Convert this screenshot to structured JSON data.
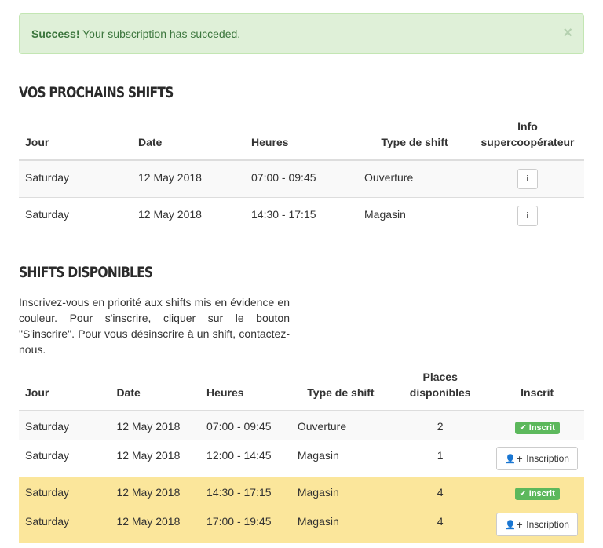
{
  "alert": {
    "strong": "Success!",
    "message": " Your subscription has succeded.",
    "close": "×"
  },
  "upcoming": {
    "title": "Vos prochains shifts",
    "headers": {
      "jour": "Jour",
      "date": "Date",
      "heures": "Heures",
      "type": "Type de shift",
      "info_line1": "Info",
      "info_line2": "supercoopérateur"
    },
    "info_icon": "i",
    "rows": [
      {
        "jour": "Saturday",
        "date": "12 May 2018",
        "heures": "07:00 - 09:45",
        "type": "Ouverture"
      },
      {
        "jour": "Saturday",
        "date": "12 May 2018",
        "heures": "14:30 - 17:15",
        "type": "Magasin"
      }
    ]
  },
  "available": {
    "title": "Shifts disponibles",
    "intro": "Inscrivez-vous en priorité aux shifts mis en évidence en couleur. Pour s'inscrire, cliquer sur le bouton \"S'inscrire\". Pour vous désinscrire à un shift, contactez-nous.",
    "headers": {
      "jour": "Jour",
      "date": "Date",
      "heures": "Heures",
      "type": "Type de shift",
      "places_line1": "Places",
      "places_line2": "disponibles",
      "inscrit": "Inscrit"
    },
    "inscrit_label": "Inscrit",
    "inscription_label": "Inscription",
    "highlight_color": "#fbe69b",
    "success_color": "#5cb85c",
    "rows": [
      {
        "jour": "Saturday",
        "date": "12 May 2018",
        "heures": "07:00 - 09:45",
        "type": "Ouverture",
        "places": "2",
        "status": "inscrit",
        "highlight": false
      },
      {
        "jour": "Saturday",
        "date": "12 May 2018",
        "heures": "12:00 - 14:45",
        "type": "Magasin",
        "places": "1",
        "status": "inscription",
        "highlight": false
      },
      {
        "jour": "Saturday",
        "date": "12 May 2018",
        "heures": "14:30 - 17:15",
        "type": "Magasin",
        "places": "4",
        "status": "inscrit",
        "highlight": true
      },
      {
        "jour": "Saturday",
        "date": "12 May 2018",
        "heures": "17:00 - 19:45",
        "type": "Magasin",
        "places": "4",
        "status": "inscription",
        "highlight": true
      }
    ]
  }
}
